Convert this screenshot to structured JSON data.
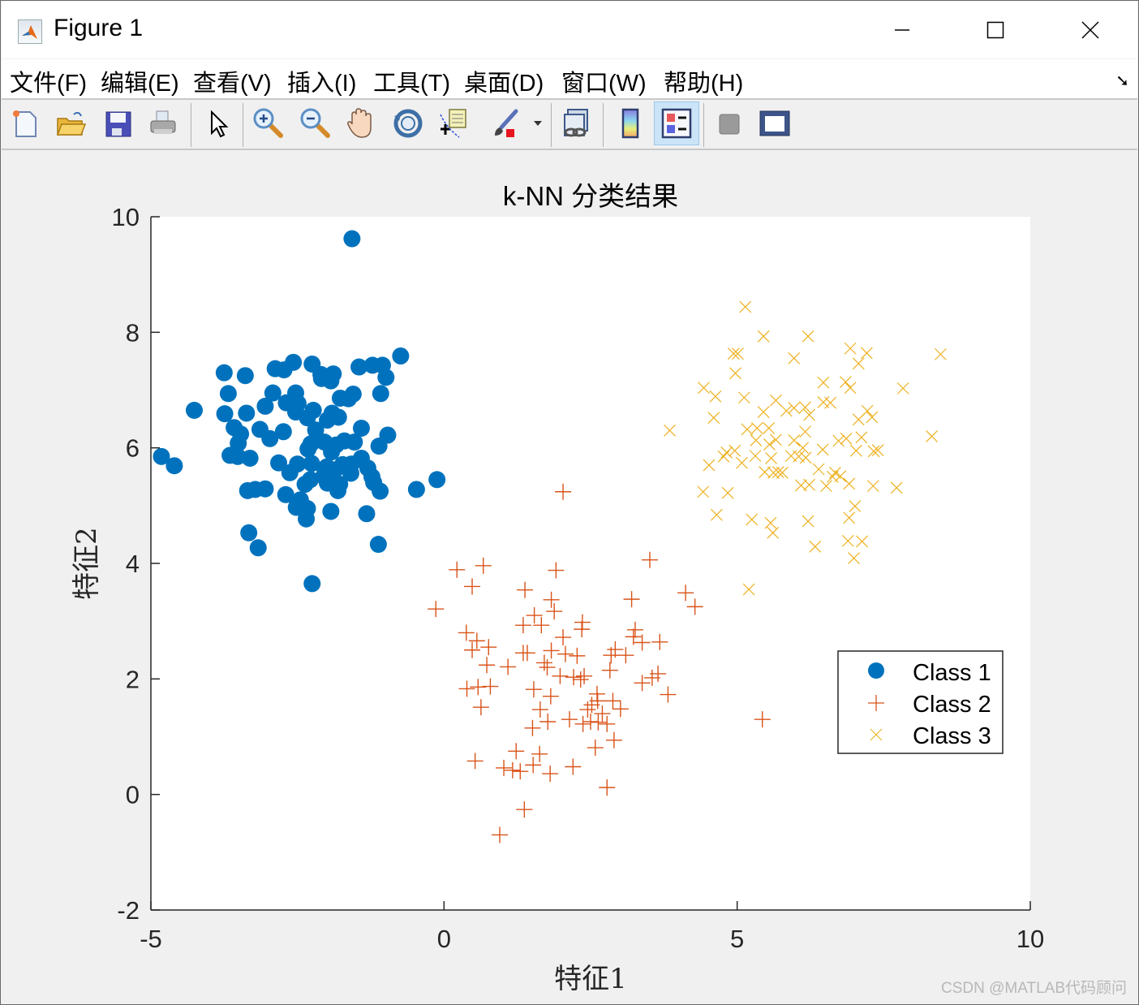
{
  "window": {
    "title": "Figure 1",
    "controls": {
      "minimize": "–",
      "maximize": "☐",
      "close": "✕"
    }
  },
  "menubar": {
    "items": [
      "文件(F)",
      "编辑(E)",
      "查看(V)",
      "插入(I)",
      "工具(T)",
      "桌面(D)",
      "窗口(W)",
      "帮助(H)"
    ],
    "dock_icon": "dock-arrow-icon"
  },
  "toolbar": {
    "buttons": [
      {
        "name": "new-figure",
        "icon": "new-file-icon"
      },
      {
        "name": "open-file",
        "icon": "folder-open-icon"
      },
      {
        "name": "save",
        "icon": "floppy-disk-icon"
      },
      {
        "name": "print",
        "icon": "printer-icon"
      },
      {
        "name": "edit-plot",
        "icon": "pointer-arrow-icon"
      },
      {
        "name": "zoom-in",
        "icon": "zoom-in-icon"
      },
      {
        "name": "zoom-out",
        "icon": "zoom-out-icon"
      },
      {
        "name": "pan",
        "icon": "hand-icon"
      },
      {
        "name": "rotate-3d",
        "icon": "rotate-icon"
      },
      {
        "name": "data-cursor",
        "icon": "data-tip-icon"
      },
      {
        "name": "brush",
        "icon": "brush-icon"
      },
      {
        "name": "link-plot",
        "icon": "link-icon"
      },
      {
        "name": "insert-colorbar",
        "icon": "colorbar-icon"
      },
      {
        "name": "insert-legend",
        "icon": "legend-icon",
        "active": true
      },
      {
        "name": "hide-plot-tools",
        "icon": "hide-tools-icon"
      },
      {
        "name": "show-plot-tools",
        "icon": "show-tools-icon"
      }
    ]
  },
  "watermark": "CSDN @MATLAB代码顾问",
  "colors": {
    "class1": "#0072bd",
    "class2": "#d95319",
    "class3": "#edb120"
  },
  "chart_data": {
    "type": "scatter",
    "title": "k-NN 分类结果",
    "xlabel": "特征1",
    "ylabel": "特征2",
    "xlim": [
      -5,
      10
    ],
    "ylim": [
      -2,
      10
    ],
    "xticks": [
      -5,
      0,
      5,
      10
    ],
    "yticks": [
      -2,
      0,
      2,
      4,
      6,
      8,
      10
    ],
    "grid": false,
    "box": false,
    "legend": {
      "placement": "lower-right",
      "entries": [
        "Class 1",
        "Class 2",
        "Class 3"
      ]
    },
    "series": [
      {
        "name": "Class 1",
        "marker": "filled-circle",
        "color": "#0072bd",
        "points": [
          [
            -1.57,
            9.62
          ],
          [
            -0.74,
            7.59
          ],
          [
            -1.22,
            7.43
          ],
          [
            -1.05,
            7.43
          ],
          [
            -1.45,
            7.4
          ],
          [
            -0.99,
            7.22
          ],
          [
            -2.57,
            7.48
          ],
          [
            -2.25,
            7.45
          ],
          [
            -2.88,
            7.37
          ],
          [
            -2.73,
            7.35
          ],
          [
            -1.89,
            7.28
          ],
          [
            -2.1,
            7.27
          ],
          [
            -3.75,
            7.3
          ],
          [
            -3.39,
            7.25
          ],
          [
            -1.93,
            7.16
          ],
          [
            -2.09,
            7.2
          ],
          [
            -3.68,
            6.94
          ],
          [
            -2.53,
            6.95
          ],
          [
            -2.92,
            6.95
          ],
          [
            -1.08,
            6.94
          ],
          [
            -1.55,
            6.93
          ],
          [
            -4.26,
            6.65
          ],
          [
            -3.05,
            6.72
          ],
          [
            -2.69,
            6.78
          ],
          [
            -2.49,
            6.77
          ],
          [
            -2.23,
            6.65
          ],
          [
            -1.77,
            6.86
          ],
          [
            -1.63,
            6.85
          ],
          [
            -2.53,
            6.62
          ],
          [
            -1.91,
            6.6
          ],
          [
            -1.8,
            6.53
          ],
          [
            -2.33,
            6.52
          ],
          [
            -3.37,
            6.6
          ],
          [
            -3.74,
            6.59
          ],
          [
            -1.99,
            6.48
          ],
          [
            -3.58,
            6.35
          ],
          [
            -3.14,
            6.32
          ],
          [
            -2.74,
            6.28
          ],
          [
            -2.19,
            6.31
          ],
          [
            -1.41,
            6.34
          ],
          [
            -0.96,
            6.22
          ],
          [
            -3.47,
            6.24
          ],
          [
            -2.27,
            6.07
          ],
          [
            -1.7,
            6.12
          ],
          [
            -2.04,
            6.1
          ],
          [
            -1.84,
            6.05
          ],
          [
            -1.53,
            6.1
          ],
          [
            -2.97,
            6.16
          ],
          [
            -3.51,
            6.08
          ],
          [
            -1.11,
            6.03
          ],
          [
            -1.92,
            5.93
          ],
          [
            -2.32,
            5.98
          ],
          [
            -3.65,
            5.87
          ],
          [
            -3.52,
            5.85
          ],
          [
            -3.31,
            5.82
          ],
          [
            -1.41,
            5.82
          ],
          [
            -4.82,
            5.85
          ],
          [
            -4.6,
            5.69
          ],
          [
            -2.82,
            5.74
          ],
          [
            -2.5,
            5.72
          ],
          [
            -2.26,
            5.73
          ],
          [
            -1.73,
            5.71
          ],
          [
            -2.0,
            5.67
          ],
          [
            -1.58,
            5.72
          ],
          [
            -2.63,
            5.57
          ],
          [
            -2.03,
            5.61
          ],
          [
            -1.86,
            5.62
          ],
          [
            -1.3,
            5.65
          ],
          [
            -1.59,
            5.56
          ],
          [
            -2.28,
            5.45
          ],
          [
            -2.05,
            5.51
          ],
          [
            -1.23,
            5.5
          ],
          [
            -2.37,
            5.37
          ],
          [
            -1.99,
            5.39
          ],
          [
            -1.78,
            5.37
          ],
          [
            -1.2,
            5.4
          ],
          [
            -0.47,
            5.28
          ],
          [
            -0.12,
            5.45
          ],
          [
            -3.22,
            5.28
          ],
          [
            -3.05,
            5.29
          ],
          [
            -3.35,
            5.26
          ],
          [
            -1.81,
            5.26
          ],
          [
            -1.09,
            5.25
          ],
          [
            -2.7,
            5.19
          ],
          [
            -2.45,
            5.1
          ],
          [
            -2.52,
            4.97
          ],
          [
            -2.33,
            4.95
          ],
          [
            -1.93,
            4.9
          ],
          [
            -1.32,
            4.86
          ],
          [
            -2.35,
            4.77
          ],
          [
            -3.33,
            4.53
          ],
          [
            -3.17,
            4.27
          ],
          [
            -1.12,
            4.33
          ],
          [
            -2.25,
            3.65
          ]
        ]
      },
      {
        "name": "Class 2",
        "marker": "plus",
        "color": "#d95319",
        "points": [
          [
            2.03,
            5.24
          ],
          [
            3.51,
            4.06
          ],
          [
            0.67,
            3.96
          ],
          [
            0.22,
            3.89
          ],
          [
            1.91,
            3.88
          ],
          [
            0.48,
            3.6
          ],
          [
            1.38,
            3.54
          ],
          [
            1.83,
            3.37
          ],
          [
            3.2,
            3.38
          ],
          [
            4.12,
            3.49
          ],
          [
            4.28,
            3.25
          ],
          [
            -0.14,
            3.21
          ],
          [
            1.54,
            3.1
          ],
          [
            1.88,
            3.17
          ],
          [
            1.66,
            2.93
          ],
          [
            1.35,
            2.93
          ],
          [
            2.36,
            2.98
          ],
          [
            2.35,
            2.86
          ],
          [
            3.26,
            2.85
          ],
          [
            2.03,
            2.72
          ],
          [
            3.23,
            2.73
          ],
          [
            3.38,
            2.63
          ],
          [
            3.68,
            2.64
          ],
          [
            0.38,
            2.8
          ],
          [
            0.56,
            2.66
          ],
          [
            0.76,
            2.55
          ],
          [
            0.48,
            2.5
          ],
          [
            1.35,
            2.45
          ],
          [
            1.42,
            2.45
          ],
          [
            1.83,
            2.49
          ],
          [
            2.07,
            2.43
          ],
          [
            2.27,
            2.4
          ],
          [
            2.85,
            2.41
          ],
          [
            2.92,
            2.51
          ],
          [
            3.1,
            2.41
          ],
          [
            0.73,
            2.24
          ],
          [
            1.09,
            2.21
          ],
          [
            1.71,
            2.28
          ],
          [
            1.76,
            2.2
          ],
          [
            1.98,
            2.05
          ],
          [
            2.21,
            2.03
          ],
          [
            2.39,
            2.05
          ],
          [
            2.33,
            1.99
          ],
          [
            2.83,
            2.15
          ],
          [
            3.65,
            2.09
          ],
          [
            3.55,
            2.02
          ],
          [
            0.39,
            1.83
          ],
          [
            0.58,
            1.86
          ],
          [
            0.79,
            1.87
          ],
          [
            1.53,
            1.82
          ],
          [
            1.82,
            1.7
          ],
          [
            2.61,
            1.74
          ],
          [
            2.62,
            1.62
          ],
          [
            2.88,
            1.62
          ],
          [
            3.01,
            1.48
          ],
          [
            3.38,
            1.93
          ],
          [
            3.82,
            1.73
          ],
          [
            0.63,
            1.51
          ],
          [
            1.64,
            1.47
          ],
          [
            2.45,
            1.47
          ],
          [
            2.14,
            1.3
          ],
          [
            1.77,
            1.26
          ],
          [
            2.37,
            1.22
          ],
          [
            2.5,
            1.26
          ],
          [
            2.63,
            1.25
          ],
          [
            1.51,
            1.15
          ],
          [
            2.78,
            1.22
          ],
          [
            2.9,
            0.94
          ],
          [
            1.23,
            0.75
          ],
          [
            1.63,
            0.7
          ],
          [
            2.58,
            0.81
          ],
          [
            0.53,
            0.58
          ],
          [
            1.02,
            0.46
          ],
          [
            1.17,
            0.42
          ],
          [
            1.3,
            0.4
          ],
          [
            1.52,
            0.51
          ],
          [
            1.81,
            0.36
          ],
          [
            2.2,
            0.48
          ],
          [
            2.78,
            0.12
          ],
          [
            1.37,
            -0.26
          ],
          [
            0.95,
            -0.7
          ],
          [
            5.43,
            1.3
          ],
          [
            2.52,
            1.55
          ],
          [
            2.7,
            1.4
          ]
        ]
      },
      {
        "name": "Class 3",
        "marker": "cross",
        "color": "#edb120",
        "points": [
          [
            5.14,
            8.44
          ],
          [
            5.45,
            7.93
          ],
          [
            6.21,
            7.93
          ],
          [
            4.94,
            7.63
          ],
          [
            5.01,
            7.63
          ],
          [
            6.93,
            7.72
          ],
          [
            7.21,
            7.64
          ],
          [
            5.97,
            7.55
          ],
          [
            8.47,
            7.62
          ],
          [
            7.07,
            7.46
          ],
          [
            4.97,
            7.29
          ],
          [
            6.47,
            7.13
          ],
          [
            6.85,
            7.14
          ],
          [
            4.43,
            7.04
          ],
          [
            4.63,
            6.89
          ],
          [
            5.12,
            6.87
          ],
          [
            7.83,
            7.03
          ],
          [
            5.66,
            6.82
          ],
          [
            6.93,
            7.04
          ],
          [
            5.45,
            6.62
          ],
          [
            5.97,
            6.69
          ],
          [
            6.23,
            6.57
          ],
          [
            5.84,
            6.64
          ],
          [
            6.16,
            6.7
          ],
          [
            6.47,
            6.79
          ],
          [
            6.59,
            6.78
          ],
          [
            7.07,
            6.49
          ],
          [
            7.22,
            6.64
          ],
          [
            7.3,
            6.53
          ],
          [
            4.6,
            6.52
          ],
          [
            5.17,
            6.32
          ],
          [
            5.34,
            6.34
          ],
          [
            5.54,
            6.34
          ],
          [
            6.16,
            6.28
          ],
          [
            6.73,
            6.12
          ],
          [
            6.86,
            6.16
          ],
          [
            7.12,
            6.18
          ],
          [
            3.85,
            6.3
          ],
          [
            5.32,
            6.13
          ],
          [
            5.55,
            6.06
          ],
          [
            5.66,
            6.14
          ],
          [
            5.97,
            6.13
          ],
          [
            6.12,
            6.0
          ],
          [
            6.46,
            5.97
          ],
          [
            7.03,
            5.95
          ],
          [
            7.33,
            5.94
          ],
          [
            4.96,
            5.95
          ],
          [
            4.77,
            5.85
          ],
          [
            4.82,
            5.92
          ],
          [
            5.31,
            5.86
          ],
          [
            5.58,
            5.82
          ],
          [
            5.92,
            5.86
          ],
          [
            6.05,
            5.85
          ],
          [
            6.17,
            5.83
          ],
          [
            4.52,
            5.7
          ],
          [
            5.08,
            5.74
          ],
          [
            5.47,
            5.58
          ],
          [
            5.62,
            5.57
          ],
          [
            5.7,
            5.58
          ],
          [
            5.77,
            5.57
          ],
          [
            6.39,
            5.63
          ],
          [
            6.67,
            5.57
          ],
          [
            6.76,
            5.51
          ],
          [
            6.63,
            5.5
          ],
          [
            6.91,
            5.38
          ],
          [
            7.32,
            5.34
          ],
          [
            7.72,
            5.31
          ],
          [
            4.42,
            5.24
          ],
          [
            4.84,
            5.22
          ],
          [
            6.09,
            5.35
          ],
          [
            6.23,
            5.36
          ],
          [
            6.52,
            5.34
          ],
          [
            4.65,
            4.84
          ],
          [
            5.25,
            4.76
          ],
          [
            5.57,
            4.7
          ],
          [
            5.61,
            4.53
          ],
          [
            6.21,
            4.73
          ],
          [
            6.91,
            4.79
          ],
          [
            7.01,
            4.99
          ],
          [
            6.33,
            4.29
          ],
          [
            6.89,
            4.39
          ],
          [
            7.13,
            4.38
          ],
          [
            6.99,
            4.09
          ],
          [
            5.2,
            3.55
          ],
          [
            8.32,
            6.2
          ],
          [
            7.4,
            5.96
          ]
        ]
      }
    ]
  }
}
